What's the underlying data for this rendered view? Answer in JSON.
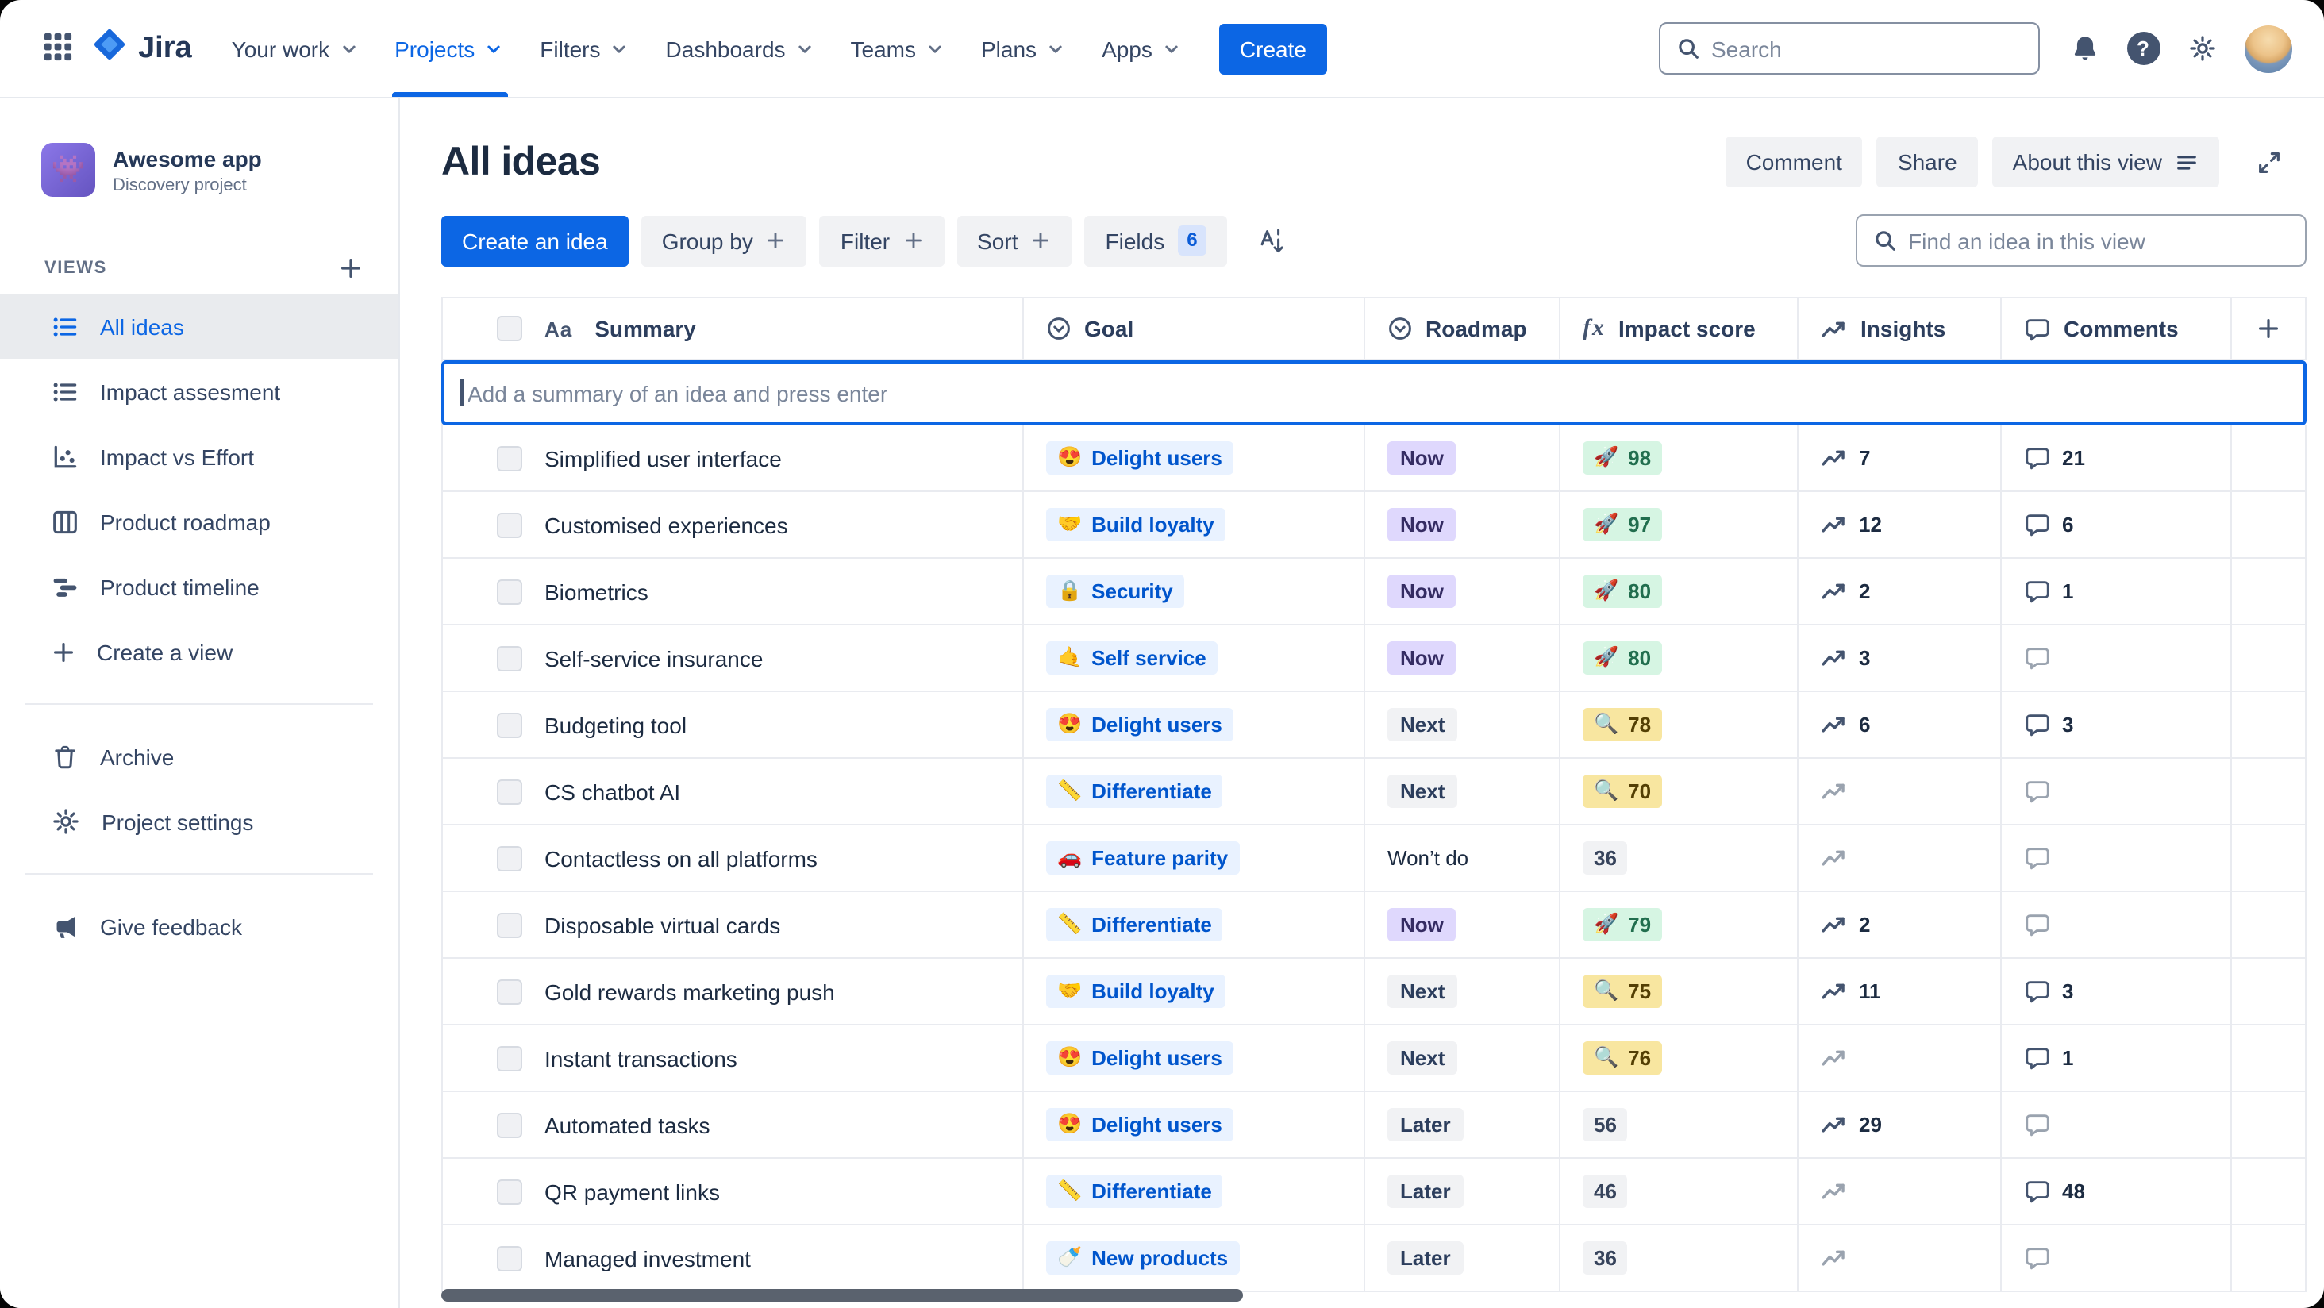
{
  "nav": {
    "brand": "Jira",
    "items": [
      {
        "label": "Your work",
        "active": false
      },
      {
        "label": "Projects",
        "active": true
      },
      {
        "label": "Filters",
        "active": false
      },
      {
        "label": "Dashboards",
        "active": false
      },
      {
        "label": "Teams",
        "active": false
      },
      {
        "label": "Plans",
        "active": false
      },
      {
        "label": "Apps",
        "active": false
      }
    ],
    "create_label": "Create",
    "search_placeholder": "Search"
  },
  "sidebar": {
    "project_name": "Awesome app",
    "project_type": "Discovery project",
    "project_emoji": "👾",
    "views_label": "VIEWS",
    "views": [
      {
        "label": "All ideas",
        "icon": "list-icon",
        "selected": true
      },
      {
        "label": "Impact assesment",
        "icon": "list-icon",
        "selected": false
      },
      {
        "label": "Impact vs Effort",
        "icon": "scatter-icon",
        "selected": false
      },
      {
        "label": "Product roadmap",
        "icon": "board-icon",
        "selected": false
      },
      {
        "label": "Product timeline",
        "icon": "timeline-icon",
        "selected": false
      },
      {
        "label": "Create a view",
        "icon": "plus-icon",
        "selected": false
      }
    ],
    "tools": [
      {
        "label": "Archive",
        "icon": "trash-icon"
      },
      {
        "label": "Project settings",
        "icon": "gear-icon"
      }
    ],
    "feedback_label": "Give feedback"
  },
  "view": {
    "title": "All ideas",
    "actions": {
      "comment": "Comment",
      "share": "Share",
      "about": "About this view"
    },
    "toolbar": {
      "create_idea": "Create an idea",
      "group_by": "Group by",
      "filter": "Filter",
      "sort": "Sort",
      "fields": "Fields",
      "fields_count": "6",
      "find_placeholder": "Find an idea in this view"
    },
    "colors": {
      "accent": "#0c66e4",
      "now_badge": "#dfd8fd",
      "neutral_badge": "#f1f2f4",
      "goal_chip": "#e9f2ff",
      "impact_green": "#d6f5e3",
      "impact_yellow": "#f8e6a0"
    },
    "table": {
      "columns": {
        "summary": "Summary",
        "goal": "Goal",
        "roadmap": "Roadmap",
        "impact": "Impact score",
        "insights": "Insights",
        "comments": "Comments"
      },
      "add_placeholder": "Add a summary of an idea and press enter",
      "rows": [
        {
          "summary": "Simplified user interface",
          "goal_emoji": "😍",
          "goal": "Delight users",
          "roadmap": "Now",
          "roadmap_color": "purple",
          "impact_emoji": "🚀",
          "impact": "98",
          "impact_color": "green",
          "insights": "7",
          "comments": "21"
        },
        {
          "summary": "Customised experiences",
          "goal_emoji": "🤝",
          "goal": "Build loyalty",
          "roadmap": "Now",
          "roadmap_color": "purple",
          "impact_emoji": "🚀",
          "impact": "97",
          "impact_color": "green",
          "insights": "12",
          "comments": "6"
        },
        {
          "summary": "Biometrics",
          "goal_emoji": "🔒",
          "goal": "Security",
          "roadmap": "Now",
          "roadmap_color": "purple",
          "impact_emoji": "🚀",
          "impact": "80",
          "impact_color": "green",
          "insights": "2",
          "comments": "1"
        },
        {
          "summary": "Self-service insurance",
          "goal_emoji": "🤙",
          "goal": "Self service",
          "roadmap": "Now",
          "roadmap_color": "purple",
          "impact_emoji": "🚀",
          "impact": "80",
          "impact_color": "green",
          "insights": "3",
          "comments": ""
        },
        {
          "summary": "Budgeting tool",
          "goal_emoji": "😍",
          "goal": "Delight users",
          "roadmap": "Next",
          "roadmap_color": "gray",
          "impact_emoji": "🔍",
          "impact": "78",
          "impact_color": "yellow",
          "insights": "6",
          "comments": "3"
        },
        {
          "summary": "CS chatbot AI",
          "goal_emoji": "📏",
          "goal": "Differentiate",
          "roadmap": "Next",
          "roadmap_color": "gray",
          "impact_emoji": "🔍",
          "impact": "70",
          "impact_color": "yellow",
          "insights": "",
          "comments": ""
        },
        {
          "summary": "Contactless on all platforms",
          "goal_emoji": "🚗",
          "goal": "Feature parity",
          "roadmap": "Won’t do",
          "roadmap_color": "none",
          "impact_emoji": "",
          "impact": "36",
          "impact_color": "gray",
          "insights": "",
          "comments": ""
        },
        {
          "summary": "Disposable virtual cards",
          "goal_emoji": "📏",
          "goal": "Differentiate",
          "roadmap": "Now",
          "roadmap_color": "purple",
          "impact_emoji": "🚀",
          "impact": "79",
          "impact_color": "green",
          "insights": "2",
          "comments": ""
        },
        {
          "summary": "Gold rewards marketing push",
          "goal_emoji": "🤝",
          "goal": "Build loyalty",
          "roadmap": "Next",
          "roadmap_color": "gray",
          "impact_emoji": "🔍",
          "impact": "75",
          "impact_color": "yellow",
          "insights": "11",
          "comments": "3"
        },
        {
          "summary": "Instant transactions",
          "goal_emoji": "😍",
          "goal": "Delight users",
          "roadmap": "Next",
          "roadmap_color": "gray",
          "impact_emoji": "🔍",
          "impact": "76",
          "impact_color": "yellow",
          "insights": "",
          "comments": "1"
        },
        {
          "summary": "Automated tasks",
          "goal_emoji": "😍",
          "goal": "Delight users",
          "roadmap": "Later",
          "roadmap_color": "gray",
          "impact_emoji": "",
          "impact": "56",
          "impact_color": "gray",
          "insights": "29",
          "comments": ""
        },
        {
          "summary": "QR payment links",
          "goal_emoji": "📏",
          "goal": "Differentiate",
          "roadmap": "Later",
          "roadmap_color": "gray",
          "impact_emoji": "",
          "impact": "46",
          "impact_color": "gray",
          "insights": "",
          "comments": "48"
        },
        {
          "summary": "Managed investment",
          "goal_emoji": "🍼",
          "goal": "New products",
          "roadmap": "Later",
          "roadmap_color": "gray",
          "impact_emoji": "",
          "impact": "36",
          "impact_color": "gray",
          "insights": "",
          "comments": ""
        }
      ]
    }
  }
}
